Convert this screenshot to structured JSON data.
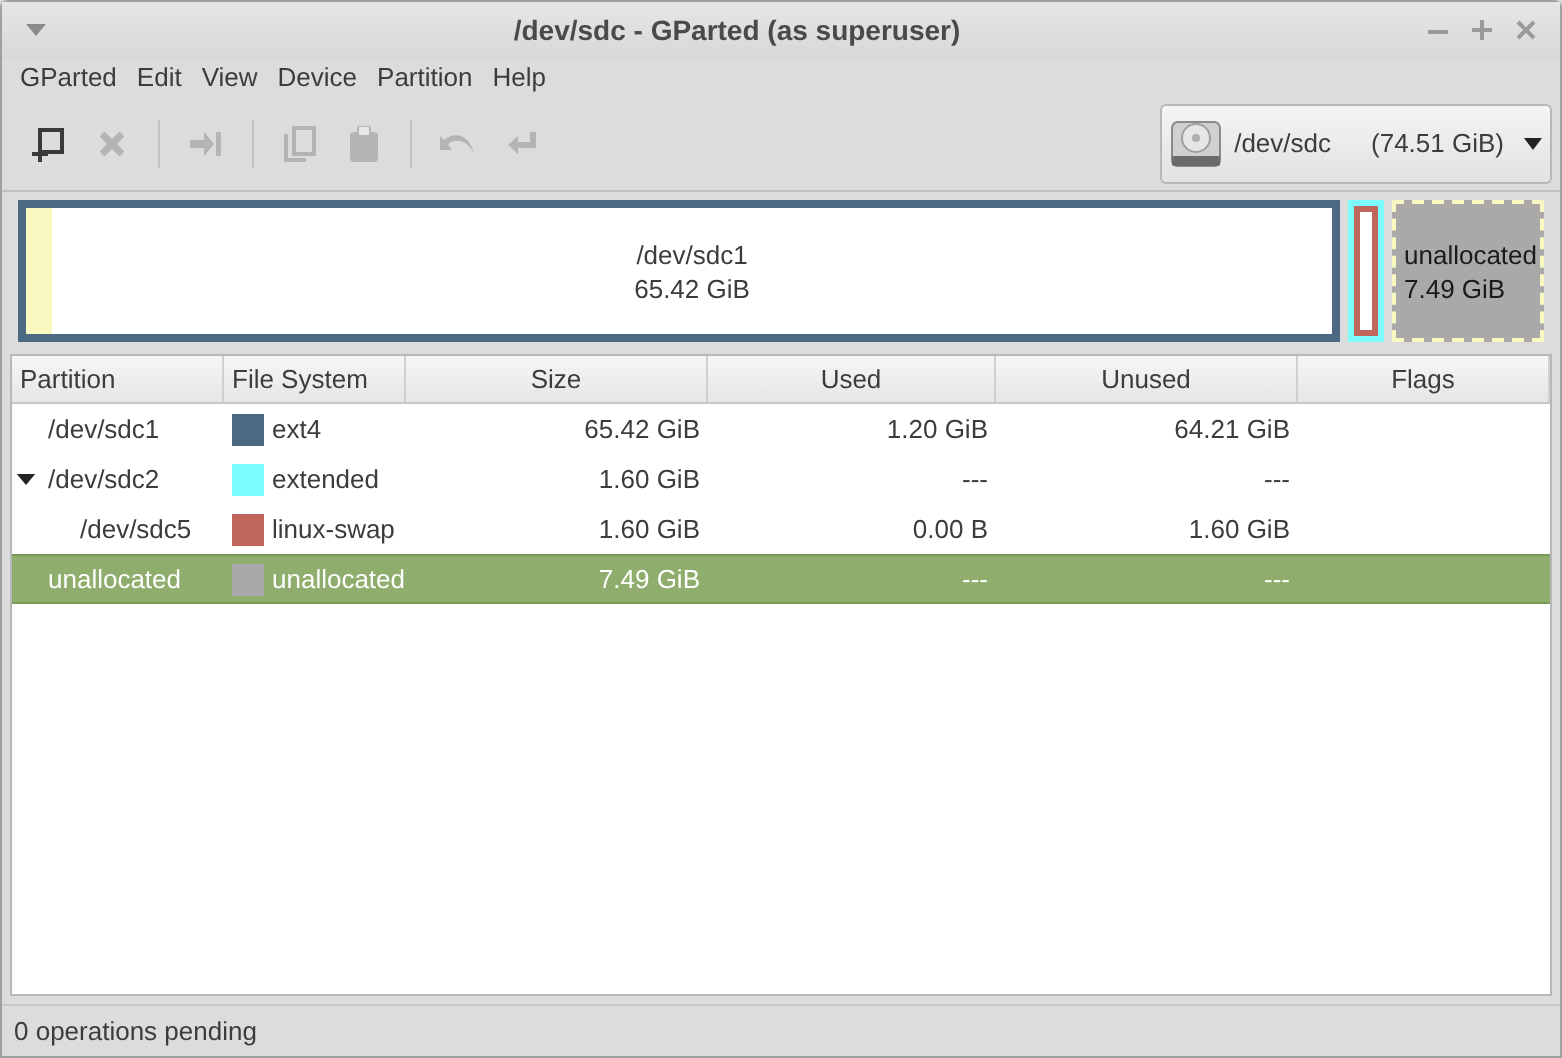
{
  "window": {
    "title": "/dev/sdc - GParted (as superuser)"
  },
  "menu": [
    "GParted",
    "Edit",
    "View",
    "Device",
    "Partition",
    "Help"
  ],
  "toolbar": [
    {
      "kind": "new",
      "disabled": false
    },
    {
      "kind": "delete",
      "disabled": true
    },
    {
      "kind": "resize",
      "disabled": true
    },
    {
      "kind": "copy",
      "disabled": true
    },
    {
      "kind": "paste",
      "disabled": true
    },
    {
      "kind": "undo",
      "disabled": true
    },
    {
      "kind": "apply",
      "disabled": true
    }
  ],
  "device": {
    "name": "/dev/sdc",
    "size": "(74.51 GiB)"
  },
  "map": [
    {
      "kind": "primary",
      "name": "/dev/sdc1",
      "size": "65.42 GiB",
      "color": "#4b6983",
      "level": 0.02
    },
    {
      "kind": "extended",
      "color": "#7dfcfe",
      "logical": [
        {
          "color": "#c1665a"
        }
      ]
    },
    {
      "kind": "unallocated",
      "name": "unallocated",
      "size": "7.49 GiB",
      "color": "#a9a9a9"
    }
  ],
  "table": {
    "columns": [
      "Partition",
      "File System",
      "Size",
      "Used",
      "Unused",
      "Flags"
    ],
    "rows": [
      {
        "partition": "/dev/sdc1",
        "fs": "ext4",
        "color": "#4b6983",
        "size": "65.42 GiB",
        "used": "1.20 GiB",
        "unused": "64.21 GiB",
        "selected": false
      },
      {
        "partition": "/dev/sdc2",
        "fs": "extended",
        "color": "#7dfcfe",
        "size": "1.60 GiB",
        "used": "---",
        "unused": "---",
        "selected": false,
        "expanded": true,
        "children": [
          {
            "partition": "/dev/sdc5",
            "fs": "linux-swap",
            "color": "#c1665a",
            "size": "1.60 GiB",
            "used": "0.00 B",
            "unused": "1.60 GiB",
            "selected": false
          }
        ]
      },
      {
        "partition": "unallocated",
        "fs": "unallocated",
        "color": "#a9a9a9",
        "size": "7.49 GiB",
        "used": "---",
        "unused": "---",
        "selected": true
      }
    ]
  },
  "status_bar": "0 operations pending"
}
